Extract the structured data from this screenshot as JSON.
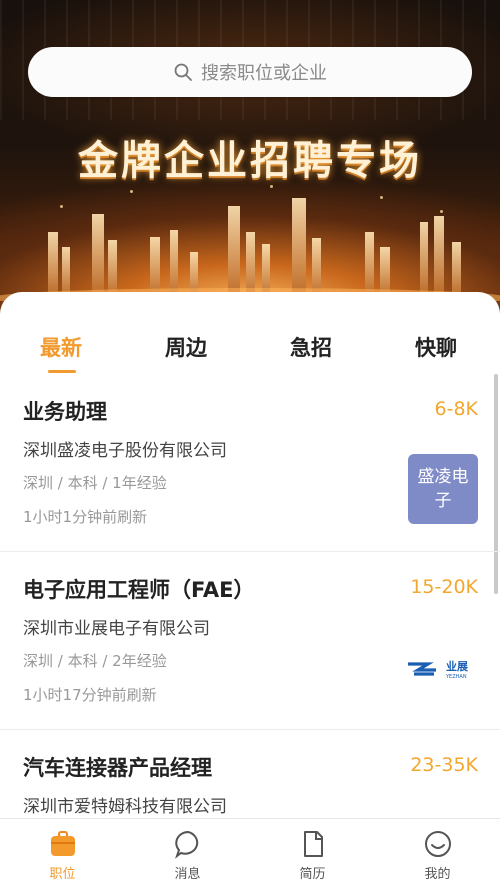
{
  "search": {
    "placeholder": "搜索职位或企业"
  },
  "banner": {
    "title": "金牌企业招聘专场"
  },
  "tabs": [
    {
      "label": "最新",
      "active": true
    },
    {
      "label": "周边",
      "active": false
    },
    {
      "label": "急招",
      "active": false
    },
    {
      "label": "快聊",
      "active": false
    }
  ],
  "jobs": [
    {
      "title": "业务助理",
      "salary": "6-8K",
      "company": "深圳盛凌电子股份有限公司",
      "requirements": "深圳 / 本科 / 1年经验",
      "refreshed": "1小时1分钟前刷新",
      "logo_text": "盛凌电子"
    },
    {
      "title": "电子应用工程师（FAE）",
      "salary": "15-20K",
      "company": "深圳市业展电子有限公司",
      "requirements": "深圳 / 本科 / 2年经验",
      "refreshed": "1小时17分钟前刷新",
      "logo_text": "业展",
      "logo_subtext": "YEZHAN"
    },
    {
      "title": "汽车连接器产品经理",
      "salary": "23-35K",
      "company": "深圳市爱特姆科技有限公司",
      "requirements": "",
      "refreshed": ""
    }
  ],
  "bottom_nav": [
    {
      "label": "职位",
      "icon": "briefcase-icon",
      "active": true
    },
    {
      "label": "消息",
      "icon": "chat-bubble-icon",
      "active": false
    },
    {
      "label": "简历",
      "icon": "document-icon",
      "active": false
    },
    {
      "label": "我的",
      "icon": "smiley-face-icon",
      "active": false
    }
  ],
  "colors": {
    "accent": "#f29a2e",
    "salary": "#f2a72e",
    "logo_bg": "#7f8bc6",
    "yezhan_blue": "#1a5fb4"
  }
}
